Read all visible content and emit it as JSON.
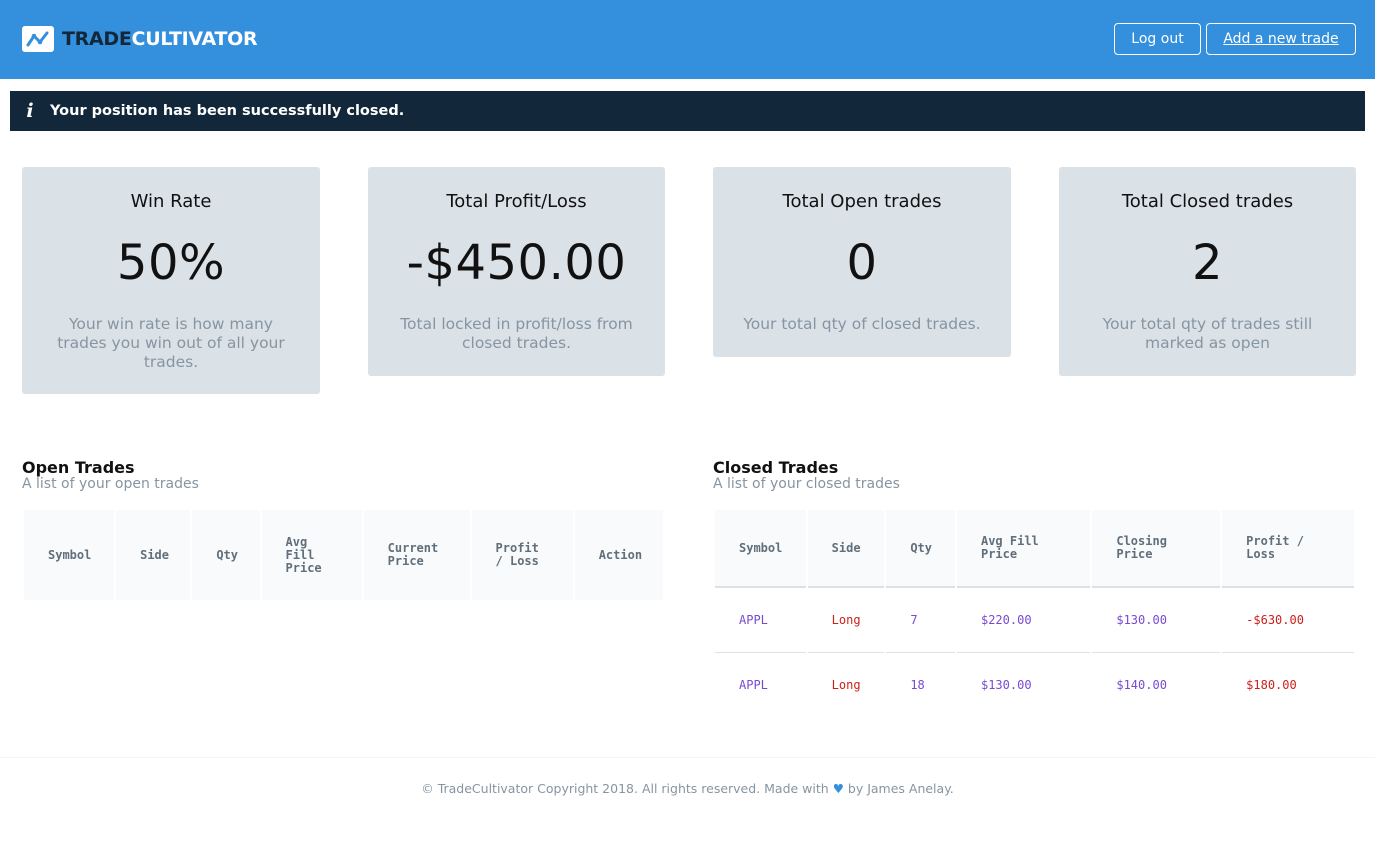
{
  "header": {
    "logo_dark": "TRADE",
    "logo_light": "CULTIVATOR",
    "logout_label": "Log out",
    "add_trade_label": "Add a new trade"
  },
  "alert": {
    "icon": "info-icon",
    "message": "Your position has been successfully closed."
  },
  "stats": [
    {
      "title": "Win Rate",
      "value": "50%",
      "description": "Your win rate is how many trades you win out of all your trades."
    },
    {
      "title": "Total Profit/Loss",
      "value": "-$450.00",
      "description": "Total locked in profit/loss from closed trades."
    },
    {
      "title": "Total Open trades",
      "value": "0",
      "description": "Your total qty of closed trades."
    },
    {
      "title": "Total Closed trades",
      "value": "2",
      "description": "Your total qty of trades still marked as open"
    }
  ],
  "open_trades": {
    "title": "Open Trades",
    "subtitle": "A list of your open trades",
    "columns": [
      "Symbol",
      "Side",
      "Qty",
      "Avg Fill Price",
      "Current Price",
      "Profit / Loss",
      "Action"
    ],
    "rows": []
  },
  "closed_trades": {
    "title": "Closed Trades",
    "subtitle": "A list of your closed trades",
    "columns": [
      "Symbol",
      "Side",
      "Qty",
      "Avg Fill Price",
      "Closing Price",
      "Profit / Loss"
    ],
    "rows": [
      {
        "symbol": "APPL",
        "side": "Long",
        "qty": "7",
        "avg_fill_price": "$220.00",
        "closing_price": "$130.00",
        "profit_loss": "-$630.00"
      },
      {
        "symbol": "APPL",
        "side": "Long",
        "qty": "18",
        "avg_fill_price": "$130.00",
        "closing_price": "$140.00",
        "profit_loss": "$180.00"
      }
    ]
  },
  "footer": {
    "text_before": "© TradeCultivator Copyright 2018. All rights reserved. Made with",
    "heart": "♥",
    "text_after": "by James Anelay."
  },
  "colors": {
    "header_bg": "#3490dc",
    "alert_bg": "#12283a",
    "card_bg": "#dae1e7",
    "loss_red": "#cc1f1a",
    "value_purple": "#794acf"
  }
}
